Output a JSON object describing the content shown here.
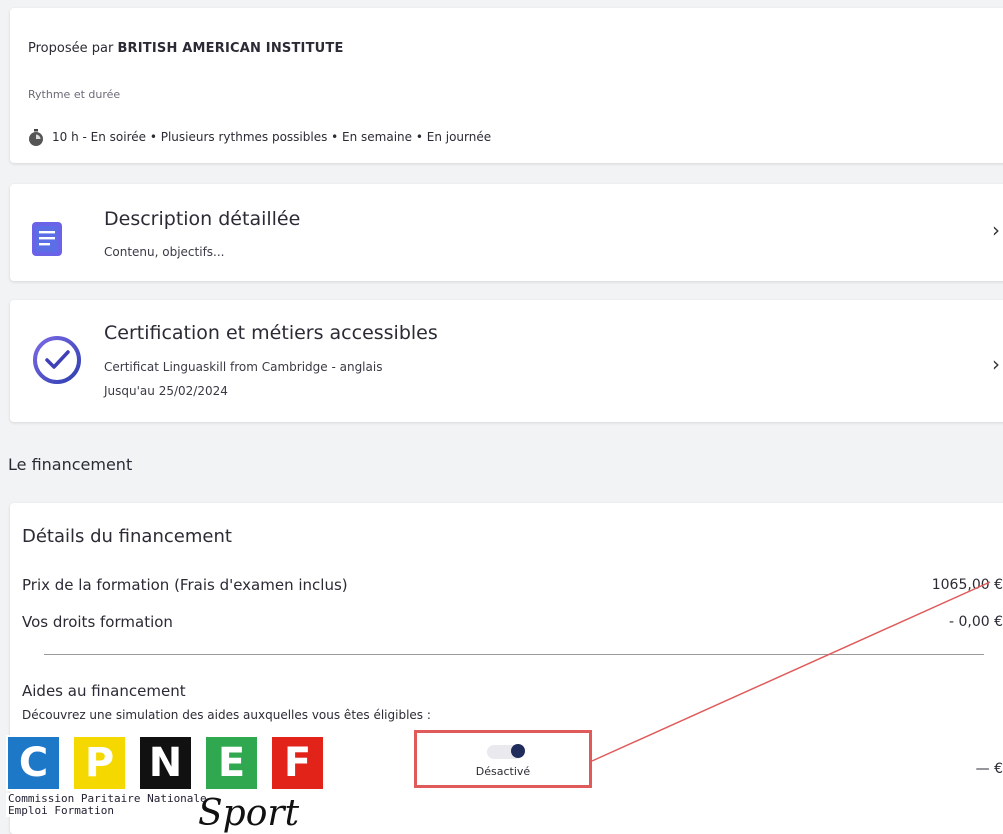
{
  "provider": {
    "prefix": "Proposée par",
    "name": "BRITISH AMERICAN INSTITUTE"
  },
  "rhythm": {
    "label": "Rythme et durée",
    "icon": "stopwatch-icon",
    "text": "10 h -  En soirée • Plusieurs rythmes possibles • En semaine • En journée"
  },
  "description_card": {
    "title": "Description détaillée",
    "subtitle": "Contenu, objectifs...",
    "icon": "document-icon",
    "icon_color": "#6a63e8"
  },
  "certification_card": {
    "title": "Certification et métiers accessibles",
    "line1": "Certificat Linguaskill from Cambridge - anglais",
    "line2": "Jusqu'au 25/02/2024",
    "icon": "check-circle-icon",
    "icon_color": "#3f3fb8"
  },
  "financing": {
    "section_title": "Le financement",
    "details_title": "Détails du financement",
    "price_label": "Prix de la formation (Frais d'examen inclus)",
    "price_value": "1065,00 €",
    "rights_label": "Vos droits formation",
    "rights_value": "- 0,00 €",
    "aids_title": "Aides au financement",
    "aids_subtitle": "Découvrez une simulation des aides auxquelles vous êtes éligibles :",
    "toggle_label": "Désactivé",
    "toggle_state": "off",
    "aid_amount": "— €"
  },
  "overlay": {
    "highlight_color": "#e05a5a",
    "logo_letters": [
      "C",
      "P",
      "N",
      "E",
      "F"
    ],
    "logo_colors": [
      "#1e78c8",
      "#f5d800",
      "#111111",
      "#2fa84f",
      "#e2231a"
    ],
    "logo_line1": "Commission Paritaire Nationale",
    "logo_line2": "Emploi Formation",
    "handwritten": "Sport"
  }
}
